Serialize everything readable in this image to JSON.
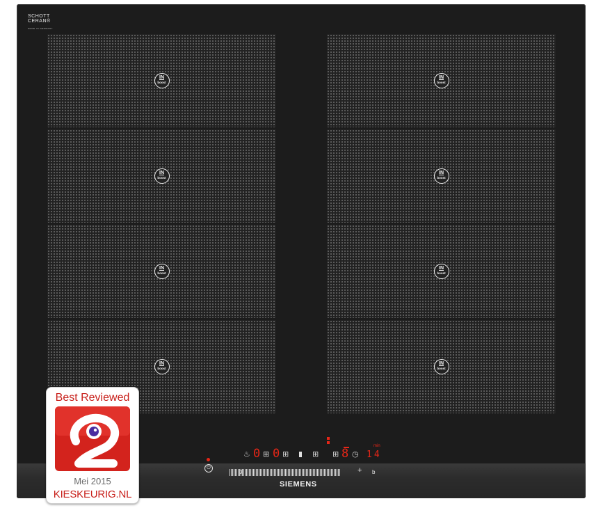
{
  "brand": {
    "name": "SIEMENS",
    "glass_line1": "SCHOTT",
    "glass_line2": "CERAN®",
    "glass_fine": "MADE IN GERMANY"
  },
  "zones": {
    "count": 8,
    "badge_top": "IN",
    "badge_bottom": "boost"
  },
  "control_panel": {
    "displays": {
      "zone_left_a": "0",
      "zone_left_b": "0",
      "zone_right": "8",
      "timer": "14"
    },
    "timer_unit": "min",
    "slider_min": "0",
    "slider_plus": "+",
    "slider_boost": "b",
    "power_symbol": "⏻",
    "clock_symbol": "◷",
    "pan_symbol": "♨",
    "zone_symbol": "⊞"
  },
  "review_badge": {
    "title": "Best Reviewed",
    "date": "Mei 2015",
    "site": "KIESKEURIG.NL"
  },
  "colors": {
    "glass": "#1c1c1c",
    "zone_dots": "#7d7d7d",
    "display_red": "#e62617",
    "badge_red": "#c8201b"
  }
}
